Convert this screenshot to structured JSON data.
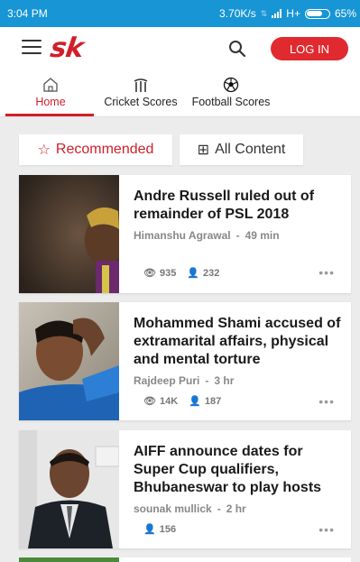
{
  "status_bar": {
    "time": "3:04 PM",
    "speed": "3.70K/s",
    "network": "H+",
    "battery": "65%"
  },
  "appbar": {
    "logo": "sk",
    "login_label": "LOG IN"
  },
  "tabs": [
    {
      "label": "Home",
      "icon": "home-icon"
    },
    {
      "label": "Cricket Scores",
      "icon": "cricket-wicket-icon"
    },
    {
      "label": "Football Scores",
      "icon": "football-icon"
    }
  ],
  "toggle": {
    "recommended": "Recommended",
    "all_content": "All Content"
  },
  "articles": [
    {
      "title": "Andre Russell ruled out of remainder of PSL 2018",
      "author": "Himanshu Agrawal",
      "time": "49 min",
      "views": "935",
      "followers": "232"
    },
    {
      "title": "Mohammed Shami accused of extramarital affairs, physical and mental torture",
      "author": "Rajdeep Puri",
      "time": "3 hr",
      "views": "14K",
      "followers": "187"
    },
    {
      "title": "AIFF announce dates for Super Cup qualifiers, Bhubaneswar to play hosts",
      "author": "sounak mullick",
      "time": "2 hr",
      "followers": "156"
    }
  ],
  "colors": {
    "status_bar": "#1795d4",
    "accent": "#d11f2a",
    "login": "#e02a2f"
  }
}
